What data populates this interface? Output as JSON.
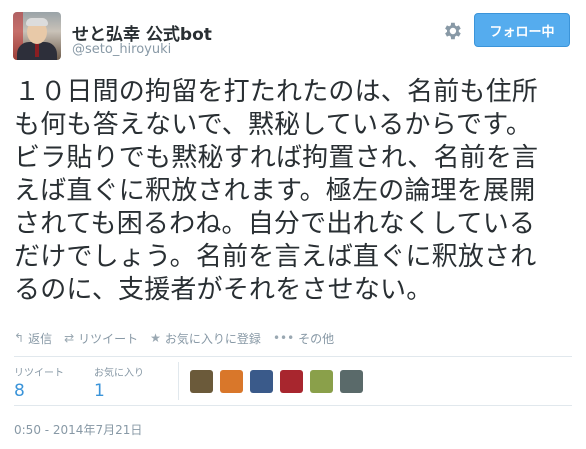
{
  "user": {
    "name": "せと弘幸 公式bot",
    "handle": "@seto_hiroyuki"
  },
  "follow_button": {
    "label": "フォロー中"
  },
  "tweet": {
    "lines": [
      "１０日間の拘留を打たれたのは、名前も住所",
      "も何も答えないで、黙秘しているからです。",
      "ビラ貼りでも黙秘すれば拘置され、名前を言",
      "えば直ぐに釈放されます。極左の論理を展開",
      "されても困るわね。自分で出れなくしている",
      "だけでしょう。名前を言えば直ぐに釈放され",
      "るのに、支援者がそれをさせない。"
    ]
  },
  "actions": [
    {
      "label": "返信",
      "icon": "reply-icon"
    },
    {
      "label": "リツイート",
      "icon": "retweet-icon"
    },
    {
      "label": "お気に入りに登録",
      "icon": "star-icon"
    },
    {
      "label": "その他",
      "icon": "more-icon"
    }
  ],
  "stats": {
    "retweets_label": "リツイート",
    "retweets_count": "8",
    "favorites_label": "お気に入り",
    "favorites_count": "1"
  },
  "favoriter_avatars": [
    {
      "color": "#6b5a3a"
    },
    {
      "color": "#d9772a"
    },
    {
      "color": "#3a5a8a"
    },
    {
      "color": "#a8262e"
    },
    {
      "color": "#8aa04a"
    },
    {
      "color": "#5a6a6a"
    }
  ],
  "timestamp": "0:50 - 2014年7月21日",
  "colors": {
    "accent": "#55acee",
    "link": "#3b94d9",
    "muted": "#8899a6"
  }
}
